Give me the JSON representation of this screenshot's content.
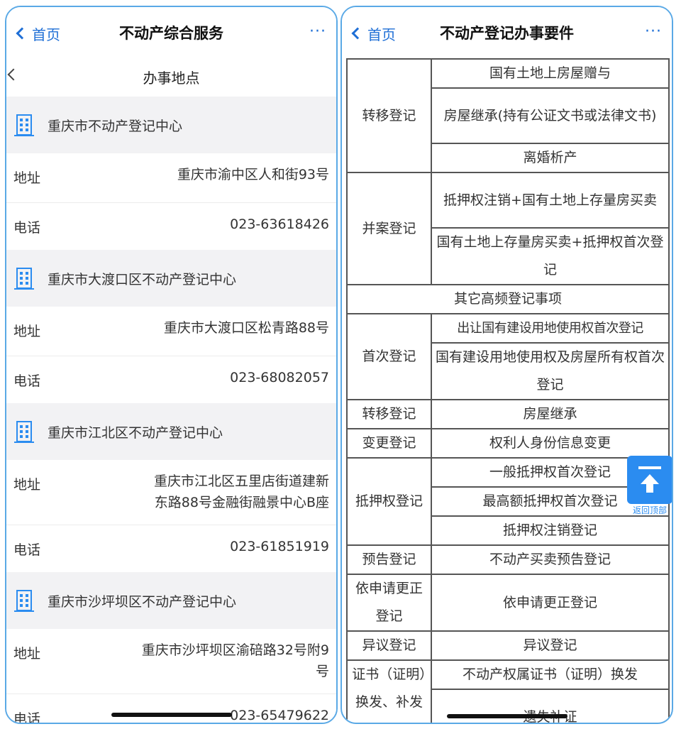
{
  "left": {
    "back_label": "首页",
    "title": "不动产综合服务",
    "more": "···",
    "subtitle": "办事地点",
    "address_label": "地址",
    "phone_label": "电话",
    "centers": [
      {
        "name": "重庆市不动产登记中心",
        "address": "重庆市渝中区人和街93号",
        "phone": "023-63618426"
      },
      {
        "name": "重庆市大渡口区不动产登记中心",
        "address": "重庆市大渡口区松青路88号",
        "phone": "023-68082057"
      },
      {
        "name": "重庆市江北区不动产登记中心",
        "address_line1": "重庆市江北区五里店街道建新",
        "address_line2": "东路88号金融街融景中心B座",
        "phone": "023-61851919"
      },
      {
        "name": "重庆市沙坪坝区不动产登记中心",
        "address_line1": "重庆市沙坪坝区渝碚路32号附9",
        "address_line2": "号",
        "phone": "023-65479622"
      }
    ]
  },
  "right": {
    "back_label": "首页",
    "title": "不动产登记办事要件",
    "more": "···",
    "rows": {
      "transfer1": "转移登记",
      "t1a": "国有土地上房屋赠与",
      "t1b": "房屋继承(持有公证文书或法律文书)",
      "t1c": "离婚析产",
      "merge": "并案登记",
      "m1": "抵押权注销+国有土地上存量房买卖",
      "m2": "国有土地上存量房买卖+抵押权首次登记",
      "other": "其它高频登记事项",
      "first": "首次登记",
      "f1": "出让国有建设用地使用权首次登记",
      "f2": "国有建设用地使用权及房屋所有权首次登记",
      "transfer2": "转移登记",
      "t2a": "房屋继承",
      "change": "变更登记",
      "c1": "权利人身份信息变更",
      "mortgage": "抵押权登记",
      "mo1": "一般抵押权首次登记",
      "mo2": "最高额抵押权首次登记",
      "mo3": "抵押权注销登记",
      "advance": "预告登记",
      "a1": "不动产买卖预告登记",
      "correct": "依申请更正登记",
      "co1": "依申请更正登记",
      "objection": "异议登记",
      "o1": "异议登记",
      "cert": "证书（证明）换发、补发",
      "ce1": "不动产权属证书（证明）换发",
      "ce2": "遗失补证"
    },
    "back_to_top": "返回顶部"
  },
  "colors": {
    "accent": "#1f6fd6",
    "back_to_top": "#2b8cf0",
    "frame": "#5aa9e6"
  }
}
